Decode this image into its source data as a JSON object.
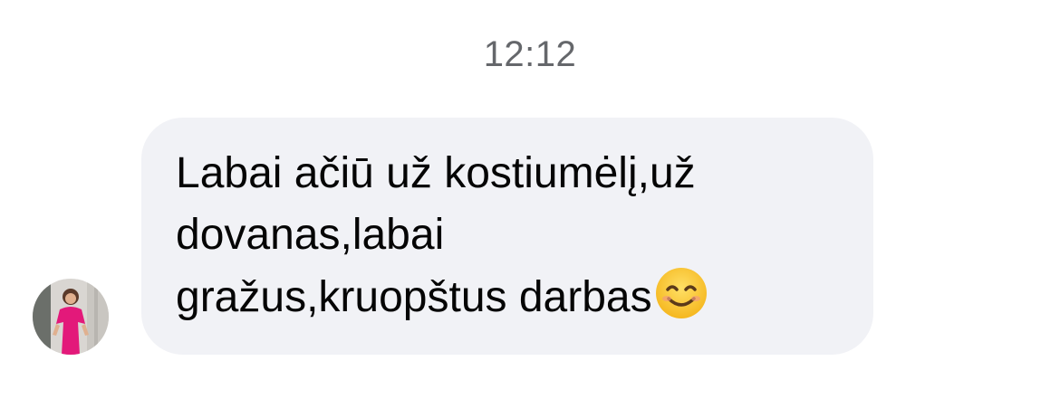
{
  "thread": {
    "timestamp": "12:12"
  },
  "message": {
    "sender_avatar_icon": "avatar-woman-pink-dress",
    "text": "Labai ačiū už kostiumėlį,už\ndovanas,labai\ngražus,kruopštus darbas",
    "trailing_emoji": "smiling-face-icon",
    "bubble_color": "#f1f2f6",
    "text_color": "#050505"
  }
}
